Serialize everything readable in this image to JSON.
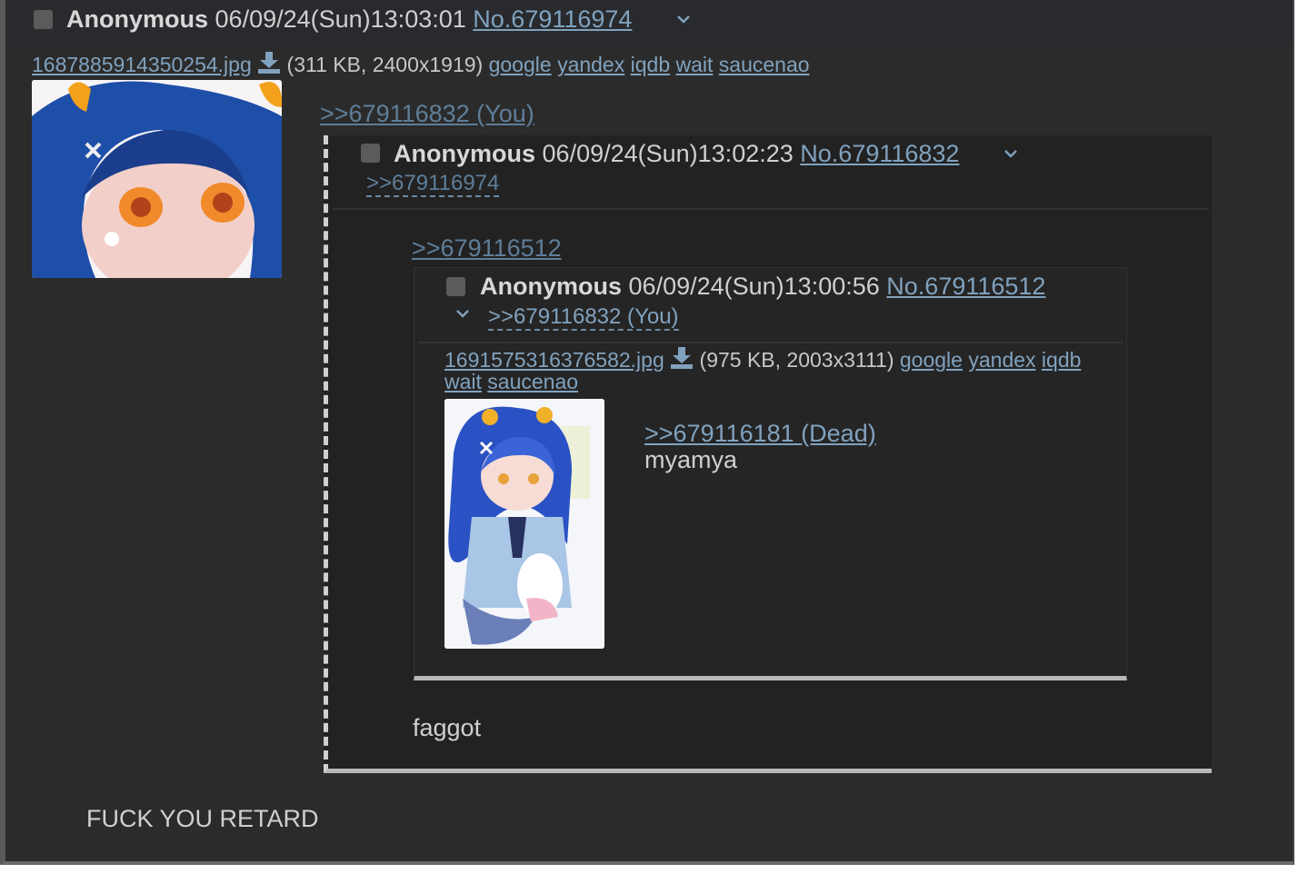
{
  "post": {
    "name": "Anonymous",
    "datetime": "06/09/24(Sun)13:03:01",
    "number": "No.679116974",
    "file": {
      "name": "1687885914350254.jpg",
      "info": "(311 KB, 2400x1919)",
      "search_links": [
        "google",
        "yandex",
        "iqdb",
        "wait",
        "saucenao"
      ]
    },
    "quote_link": ">>679116832 (You)",
    "message": "FUCK YOU RETARD"
  },
  "inline_post": {
    "name": "Anonymous",
    "datetime": "06/09/24(Sun)13:02:23",
    "number": "No.679116832",
    "backlink": ">>679116974",
    "quote_link": ">>679116512",
    "message": "faggot"
  },
  "nested_post": {
    "name": "Anonymous",
    "datetime": "06/09/24(Sun)13:00:56",
    "number": "No.679116512",
    "backlink": ">>679116832 (You)",
    "file": {
      "name": "1691575316376582.jpg",
      "info": "(975 KB, 2003x3111)",
      "search_links": [
        "google",
        "yandex",
        "iqdb",
        "wait",
        "saucenao"
      ]
    },
    "dead_link": ">>679116181 (Dead)",
    "message": "myamya"
  },
  "icons": {
    "checkbox": "checkbox-icon",
    "menu": "chevron-down-icon",
    "download": "download-icon"
  },
  "colors": {
    "link": "#81a2be",
    "background": "#282a2e"
  }
}
